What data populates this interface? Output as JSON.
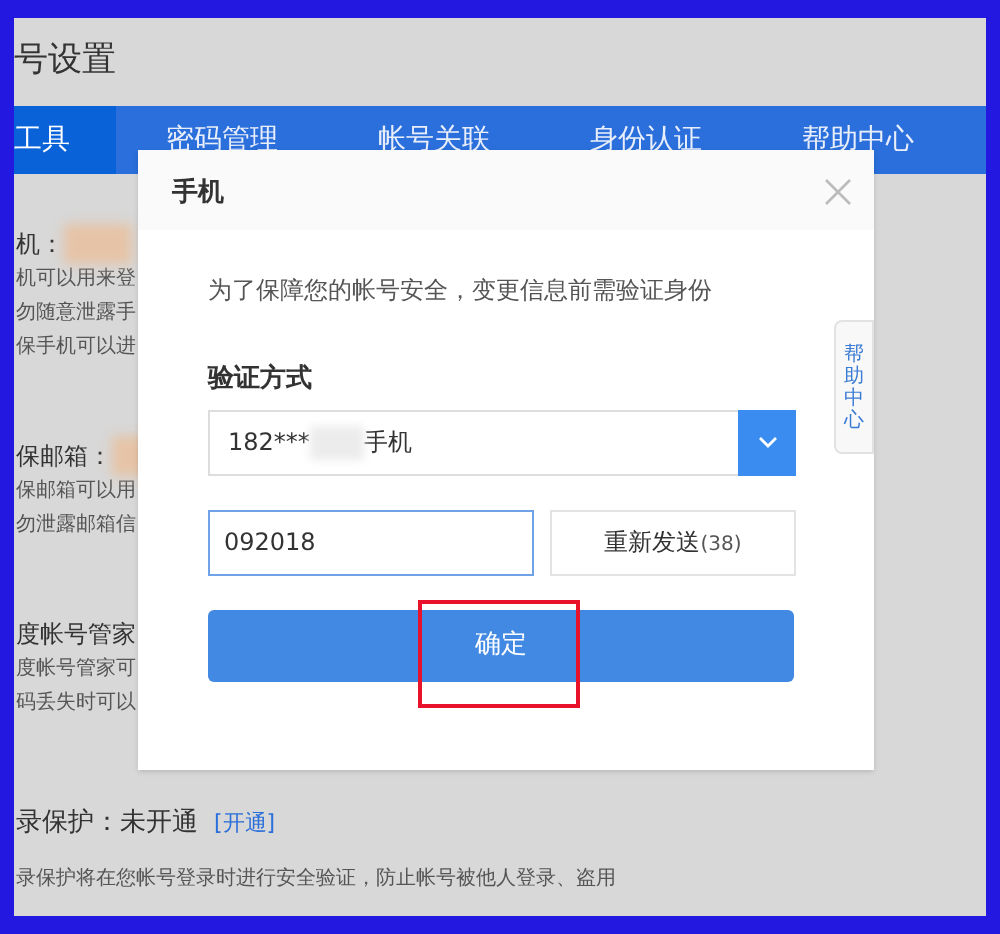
{
  "page_title": "号设置",
  "nav_tabs": [
    {
      "label": "工具",
      "selected": true
    },
    {
      "label": "密码管理",
      "selected": false
    },
    {
      "label": "帐号关联",
      "selected": false
    },
    {
      "label": "身份认证",
      "selected": false
    },
    {
      "label": "帮助中心",
      "selected": false
    }
  ],
  "sections": [
    {
      "heading": "机：",
      "redacted": true,
      "lines": [
        "机可以用来登",
        "勿随意泄露手",
        "保手机可以进"
      ]
    },
    {
      "heading": "保邮箱：",
      "redacted": true,
      "lines": [
        "保邮箱可以用",
        "勿泄露邮箱信"
      ]
    },
    {
      "heading": "度帐号管家",
      "lines": [
        "度帐号管家可",
        "码丢失时可以"
      ]
    }
  ],
  "login_protection": {
    "label": "录保护：未开通",
    "link": "[开通]",
    "description": "录保护将在您帐号登录时进行安全验证，防止帐号被他人登录、盗用"
  },
  "dialog": {
    "title": "手机",
    "notice": "为了保障您的帐号安全，变更信息前需验证身份",
    "method_label": "验证方式",
    "method_select": {
      "prefix": "182***",
      "suffix": "手机",
      "redacted": true
    },
    "code_input": {
      "value": "092018"
    },
    "resend_button": {
      "label": "重新发送",
      "countdown": "(38)"
    },
    "confirm_button": {
      "label": "确定",
      "highlighted": true
    }
  },
  "help_tab": "帮助中心"
}
